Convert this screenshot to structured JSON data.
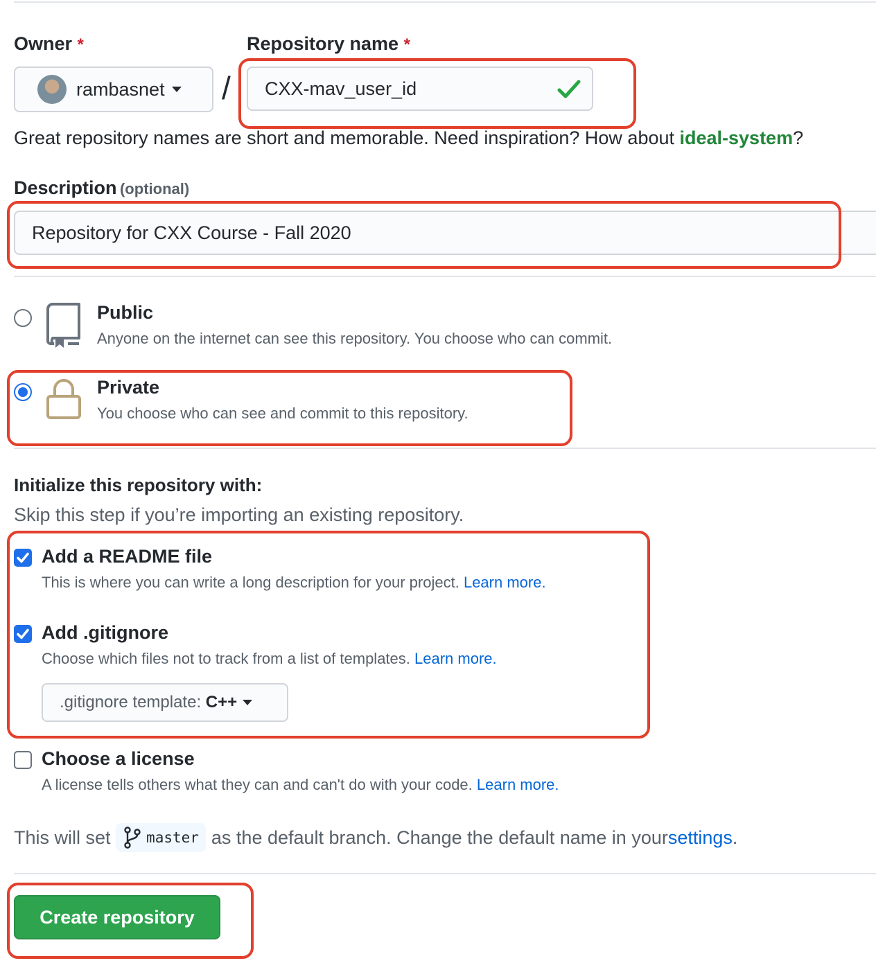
{
  "owner": {
    "label": "Owner",
    "required_mark": "*",
    "value": "rambasnet"
  },
  "separator": "/",
  "repo_name": {
    "label": "Repository name",
    "required_mark": "*",
    "value": "CXX-mav_user_id"
  },
  "hint": {
    "text": "Great repository names are short and memorable. Need inspiration? How about ",
    "suggestion": "ideal-system",
    "suffix": "?"
  },
  "description": {
    "label": "Description",
    "optional": "(optional)",
    "value": "Repository for CXX Course - Fall 2020"
  },
  "visibility": {
    "public": {
      "title": "Public",
      "desc": "Anyone on the internet can see this repository. You choose who can commit."
    },
    "private": {
      "title": "Private",
      "desc": "You choose who can see and commit to this repository."
    },
    "selected": "private"
  },
  "init": {
    "title": "Initialize this repository with:",
    "subtitle": "Skip this step if you’re importing an existing repository.",
    "readme": {
      "title": "Add a README file",
      "desc": "This is where you can write a long description for your project. ",
      "link": "Learn more.",
      "checked": true
    },
    "gitignore": {
      "title": "Add .gitignore",
      "desc": "Choose which files not to track from a list of templates. ",
      "link": "Learn more.",
      "checked": true,
      "template_label": ".gitignore template: ",
      "template_value": "C++"
    },
    "license": {
      "title": "Choose a license",
      "desc": "A license tells others what they can and can't do with your code. ",
      "link": "Learn more.",
      "checked": false
    }
  },
  "branch": {
    "prefix": "This will set ",
    "name": "master",
    "middle": " as the default branch. Change the default name in your ",
    "link": "settings",
    "suffix": "."
  },
  "create_button": "Create repository",
  "colors": {
    "accent_green": "#2ea44f",
    "highlight_red": "#e2402d",
    "link_blue": "#0366d6",
    "check_blue": "#1f6feb"
  }
}
